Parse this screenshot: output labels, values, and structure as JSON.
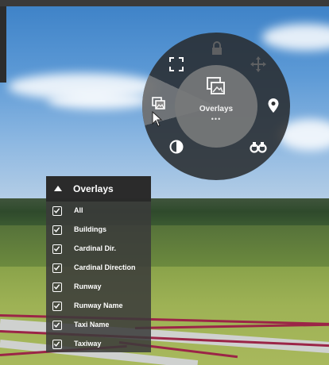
{
  "radial_menu": {
    "center_label": "Overlays",
    "center_more": "•••",
    "items": [
      {
        "name": "fullscreen",
        "icon": "fullscreen-icon"
      },
      {
        "name": "lock",
        "icon": "lock-icon"
      },
      {
        "name": "move",
        "icon": "move-icon"
      },
      {
        "name": "location",
        "icon": "map-pin-icon"
      },
      {
        "name": "binoculars",
        "icon": "binoculars-icon"
      },
      {
        "name": "contrast",
        "icon": "contrast-icon"
      },
      {
        "name": "overlays",
        "icon": "overlays-icon",
        "highlighted": true
      }
    ]
  },
  "overlays_panel": {
    "title": "Overlays",
    "items": [
      {
        "label": "All",
        "checked": true
      },
      {
        "label": "Buildings",
        "checked": true
      },
      {
        "label": "Cardinal Dir.",
        "checked": true
      },
      {
        "label": "Cardinal Direction",
        "checked": true
      },
      {
        "label": "Runway",
        "checked": true
      },
      {
        "label": "Runway Name",
        "checked": true
      },
      {
        "label": "Taxi Name",
        "checked": true
      },
      {
        "label": "Taxiway",
        "checked": true
      }
    ]
  },
  "colors": {
    "overlay_line": "#9b2547",
    "menu_dark": "#282a2c",
    "menu_center": "#76787a"
  }
}
